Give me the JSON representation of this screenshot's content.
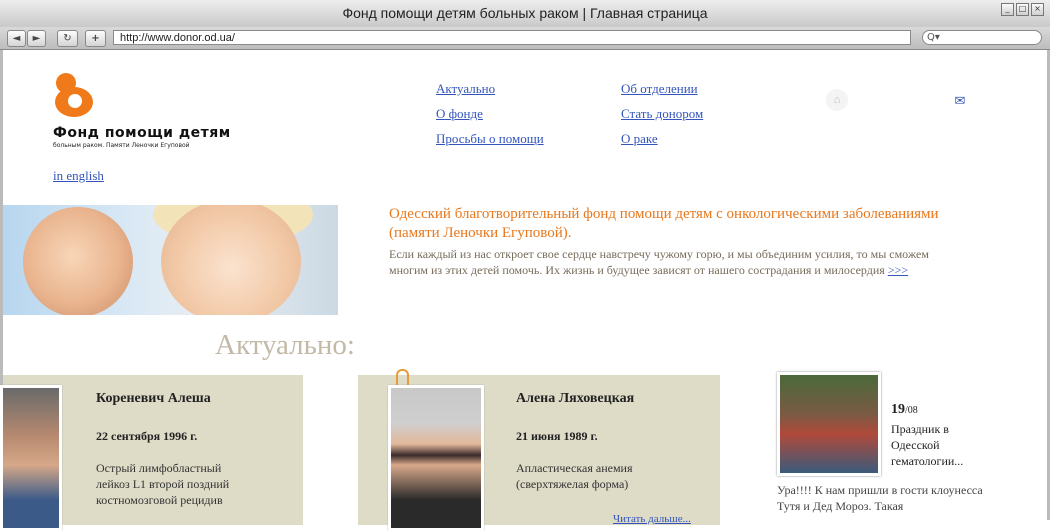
{
  "window": {
    "title": "Фонд помощи детям больных раком | Главная страница"
  },
  "browser": {
    "back_glyph": "◄",
    "forward_glyph": "►",
    "reload_glyph": "↻",
    "add_glyph": "+",
    "url": "http://www.donor.od.ua/",
    "search_glyph": "Q▾",
    "min_glyph": "_",
    "max_glyph": "□",
    "close_glyph": "×"
  },
  "header": {
    "logo_title": "Фонд помощи детям",
    "logo_subtitle": "больным раком. Памяти Леночки Егуповой",
    "english_link": "in english",
    "nav_col1": [
      "Актуально",
      "О фонде",
      "Просьбы о помощи"
    ],
    "nav_col2": [
      "Об отделении",
      "Стать донором",
      "О раке"
    ],
    "home_icon_glyph": "⌂",
    "mail_icon_glyph": "✉"
  },
  "intro": {
    "title": "Одесский благотворительный фонд помощи детям с онкологическими заболеваниями (памяти Леночки Егуповой).",
    "text": "Если каждый из нас откроет свое сердце навстречу чужому горю, и мы объединим усилия, то мы сможем многим из этих детей помочь. Их жизнь и будущее зависят от нашего сострадания и милосердия",
    "more_link": ">>>"
  },
  "section": {
    "title": "Актуально:"
  },
  "cards": [
    {
      "name": "Кореневич Алеша",
      "date": "22 сентября 1996 г.",
      "diagnosis": "Острый лимфобластный лейкоз L1 второй поздний костномозговой рецидив"
    },
    {
      "name": "Алена Ляховецкая",
      "date": "21 июня 1989 г.",
      "diagnosis": "Апластическая анемия (сверхтяжелая форма)",
      "more": "Читать дальше..."
    }
  ],
  "news": {
    "day": "19",
    "month": "/08",
    "headline": "Праздник в Одесской гематологии...",
    "text": "Ура!!!! К нам пришли в гости клоунесса Тутя и Дед Мороз. Такая"
  }
}
